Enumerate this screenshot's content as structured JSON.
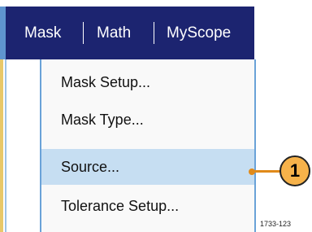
{
  "menubar": {
    "items": [
      {
        "label": "Mask"
      },
      {
        "label": "Math"
      },
      {
        "label": "MyScope"
      }
    ]
  },
  "dropdown": {
    "items": [
      {
        "label": "Mask Setup...",
        "selected": false
      },
      {
        "label": "Mask Type...",
        "selected": false
      },
      {
        "label": "Source...",
        "selected": true
      },
      {
        "label": "Tolerance Setup...",
        "selected": false
      }
    ]
  },
  "callout": {
    "number": "1"
  },
  "figure_id": "1733-123",
  "colors": {
    "menubar_bg": "#1c2470",
    "selection_bg": "#c6def2",
    "accent": "#f6b24a"
  }
}
